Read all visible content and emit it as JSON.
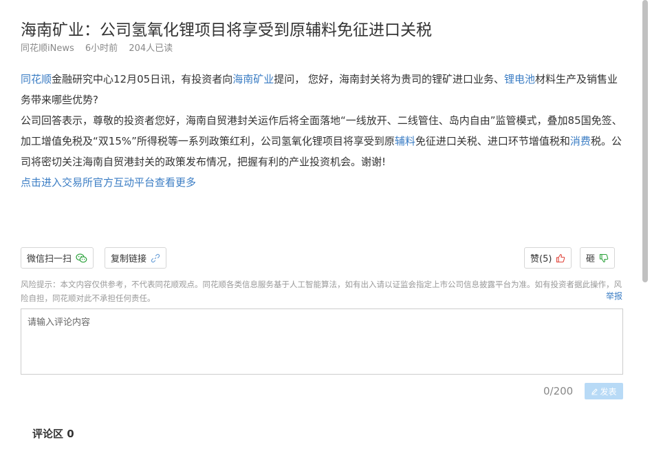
{
  "article": {
    "title": "海南矿业：公司氢氧化锂项目将享受到原辅料免征进口关税",
    "source": "同花顺iNews",
    "time": "6小时前",
    "reads": "204人已读",
    "p1": {
      "kw1": "同花顺",
      "t1": "金融研究中心12月05日讯，有投资者向",
      "kw2": "海南矿业",
      "t2": "提问， 您好，海南封关将为贵司的锂矿进口业务、",
      "kw3": "锂电池",
      "t3": "材料生产及销售业务带来哪些优势?"
    },
    "p2": {
      "t1": "公司回答表示，尊敬的投资者您好，海南自贸港封关运作后将全面落地“一线放开、二线管住、岛内自由”监管模式，叠加85国免签、加工增值免税及“双15%”所得税等一系列政策红利，公司氢氧化锂项目将享受到原",
      "kw1": "辅料",
      "t2": "免征进口关税、进口环节增值税和",
      "kw2": "消费",
      "t3": "税。公司将密切关注海南自贸港封关的政策发布情况，把握有利的产业投资机会。谢谢!"
    },
    "more_link": "点击进入交易所官方互动平台查看更多"
  },
  "actions": {
    "wechat": "微信扫一扫",
    "copy_link": "复制链接",
    "like": "赞(5)",
    "dislike": "砸"
  },
  "risk_notice": "风险提示：本文内容仅供参考，不代表同花顺观点。同花顺各类信息服务基于人工智能算法，如有出入请以证监会指定上市公司信息披露平台为准。如有投资者据此操作，风险自担，同花顺对此不承担任何责任。",
  "report": "举报",
  "comment": {
    "placeholder": "请输入评论内容",
    "counter": "0/200",
    "publish": "发表",
    "section_title": "评论区 0"
  },
  "colors": {
    "link": "#3b7dc4",
    "publish_bg": "#b8daf6",
    "like_icon": "#e0443a",
    "dislike_icon": "#2aa13a",
    "wechat_icon": "#2aa13a"
  }
}
